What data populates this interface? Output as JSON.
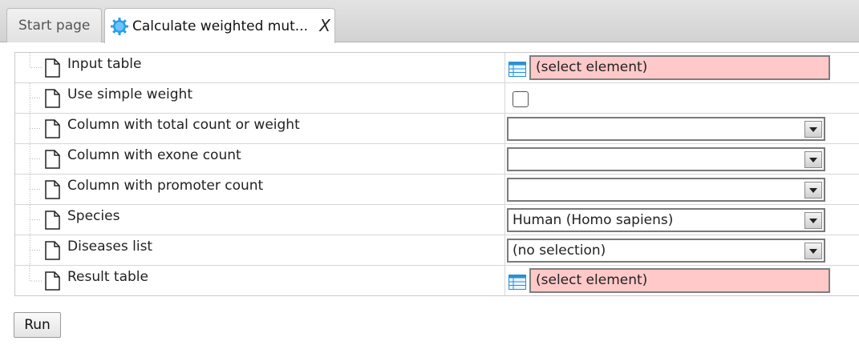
{
  "tabs": [
    {
      "label": "Start page",
      "active": false
    },
    {
      "label": "Calculate weighted mut...",
      "active": true,
      "close": "X",
      "icon": "gear-icon"
    }
  ],
  "properties": [
    {
      "label": "Input table",
      "type": "element-selector",
      "value": "(select element)",
      "icon": "table-icon"
    },
    {
      "label": "Use simple weight",
      "type": "checkbox",
      "checked": false
    },
    {
      "label": "Column with total count or weight",
      "type": "dropdown",
      "value": ""
    },
    {
      "label": "Column with exone count",
      "type": "dropdown",
      "value": ""
    },
    {
      "label": "Column with promoter count",
      "type": "dropdown",
      "value": ""
    },
    {
      "label": "Species",
      "type": "dropdown",
      "value": "Human (Homo sapiens)"
    },
    {
      "label": "Diseases list",
      "type": "dropdown",
      "value": "(no selection)"
    },
    {
      "label": "Result table",
      "type": "element-selector",
      "value": "(select element)",
      "icon": "table-icon"
    }
  ],
  "run_label": "Run",
  "colors": {
    "invalid_field": "#ffc9c9",
    "tab_icon": "#2a9ee6"
  }
}
